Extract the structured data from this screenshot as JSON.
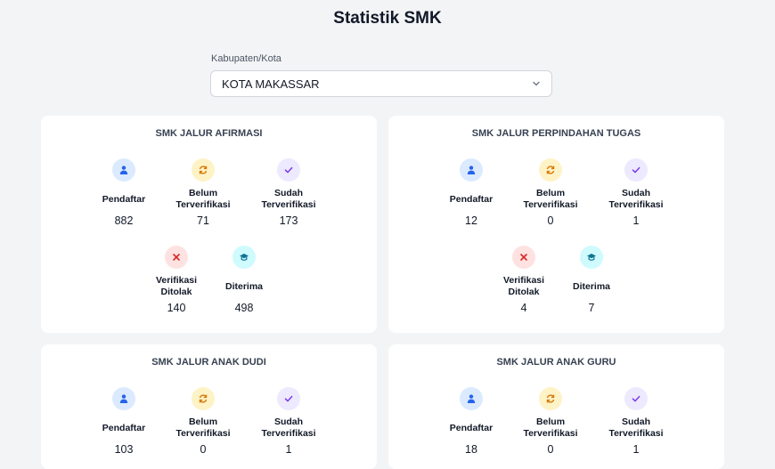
{
  "page": {
    "title": "Statistik SMK"
  },
  "filter": {
    "label": "Kabupaten/Kota",
    "value": "KOTA MAKASSAR"
  },
  "labels": {
    "pendaftar": "Pendaftar",
    "belum_1": "Belum",
    "belum_2": "Terverifikasi",
    "sudah_1": "Sudah",
    "sudah_2": "Terverifikasi",
    "ditolak_1": "Verifikasi",
    "ditolak_2": "Ditolak",
    "diterima": "Diterima"
  },
  "icons": {
    "pendaftar": "user-icon",
    "belum": "refresh-icon",
    "sudah": "check-icon",
    "ditolak": "x-icon",
    "diterima": "graduation-cap-icon"
  },
  "colors": {
    "blue": "#2563eb",
    "yellow": "#d97706",
    "purple": "#7c3aed",
    "red": "#dc2626",
    "cyan": "#0e7490"
  },
  "cards": [
    {
      "title": "SMK JALUR AFIRMASI",
      "pendaftar": "882",
      "belum": "71",
      "sudah": "173",
      "ditolak": "140",
      "diterima": "498"
    },
    {
      "title": "SMK JALUR PERPINDAHAN TUGAS",
      "pendaftar": "12",
      "belum": "0",
      "sudah": "1",
      "ditolak": "4",
      "diterima": "7"
    },
    {
      "title": "SMK JALUR ANAK DUDI",
      "pendaftar": "103",
      "belum": "0",
      "sudah": "1"
    },
    {
      "title": "SMK JALUR ANAK GURU",
      "pendaftar": "18",
      "belum": "0",
      "sudah": "1"
    }
  ]
}
